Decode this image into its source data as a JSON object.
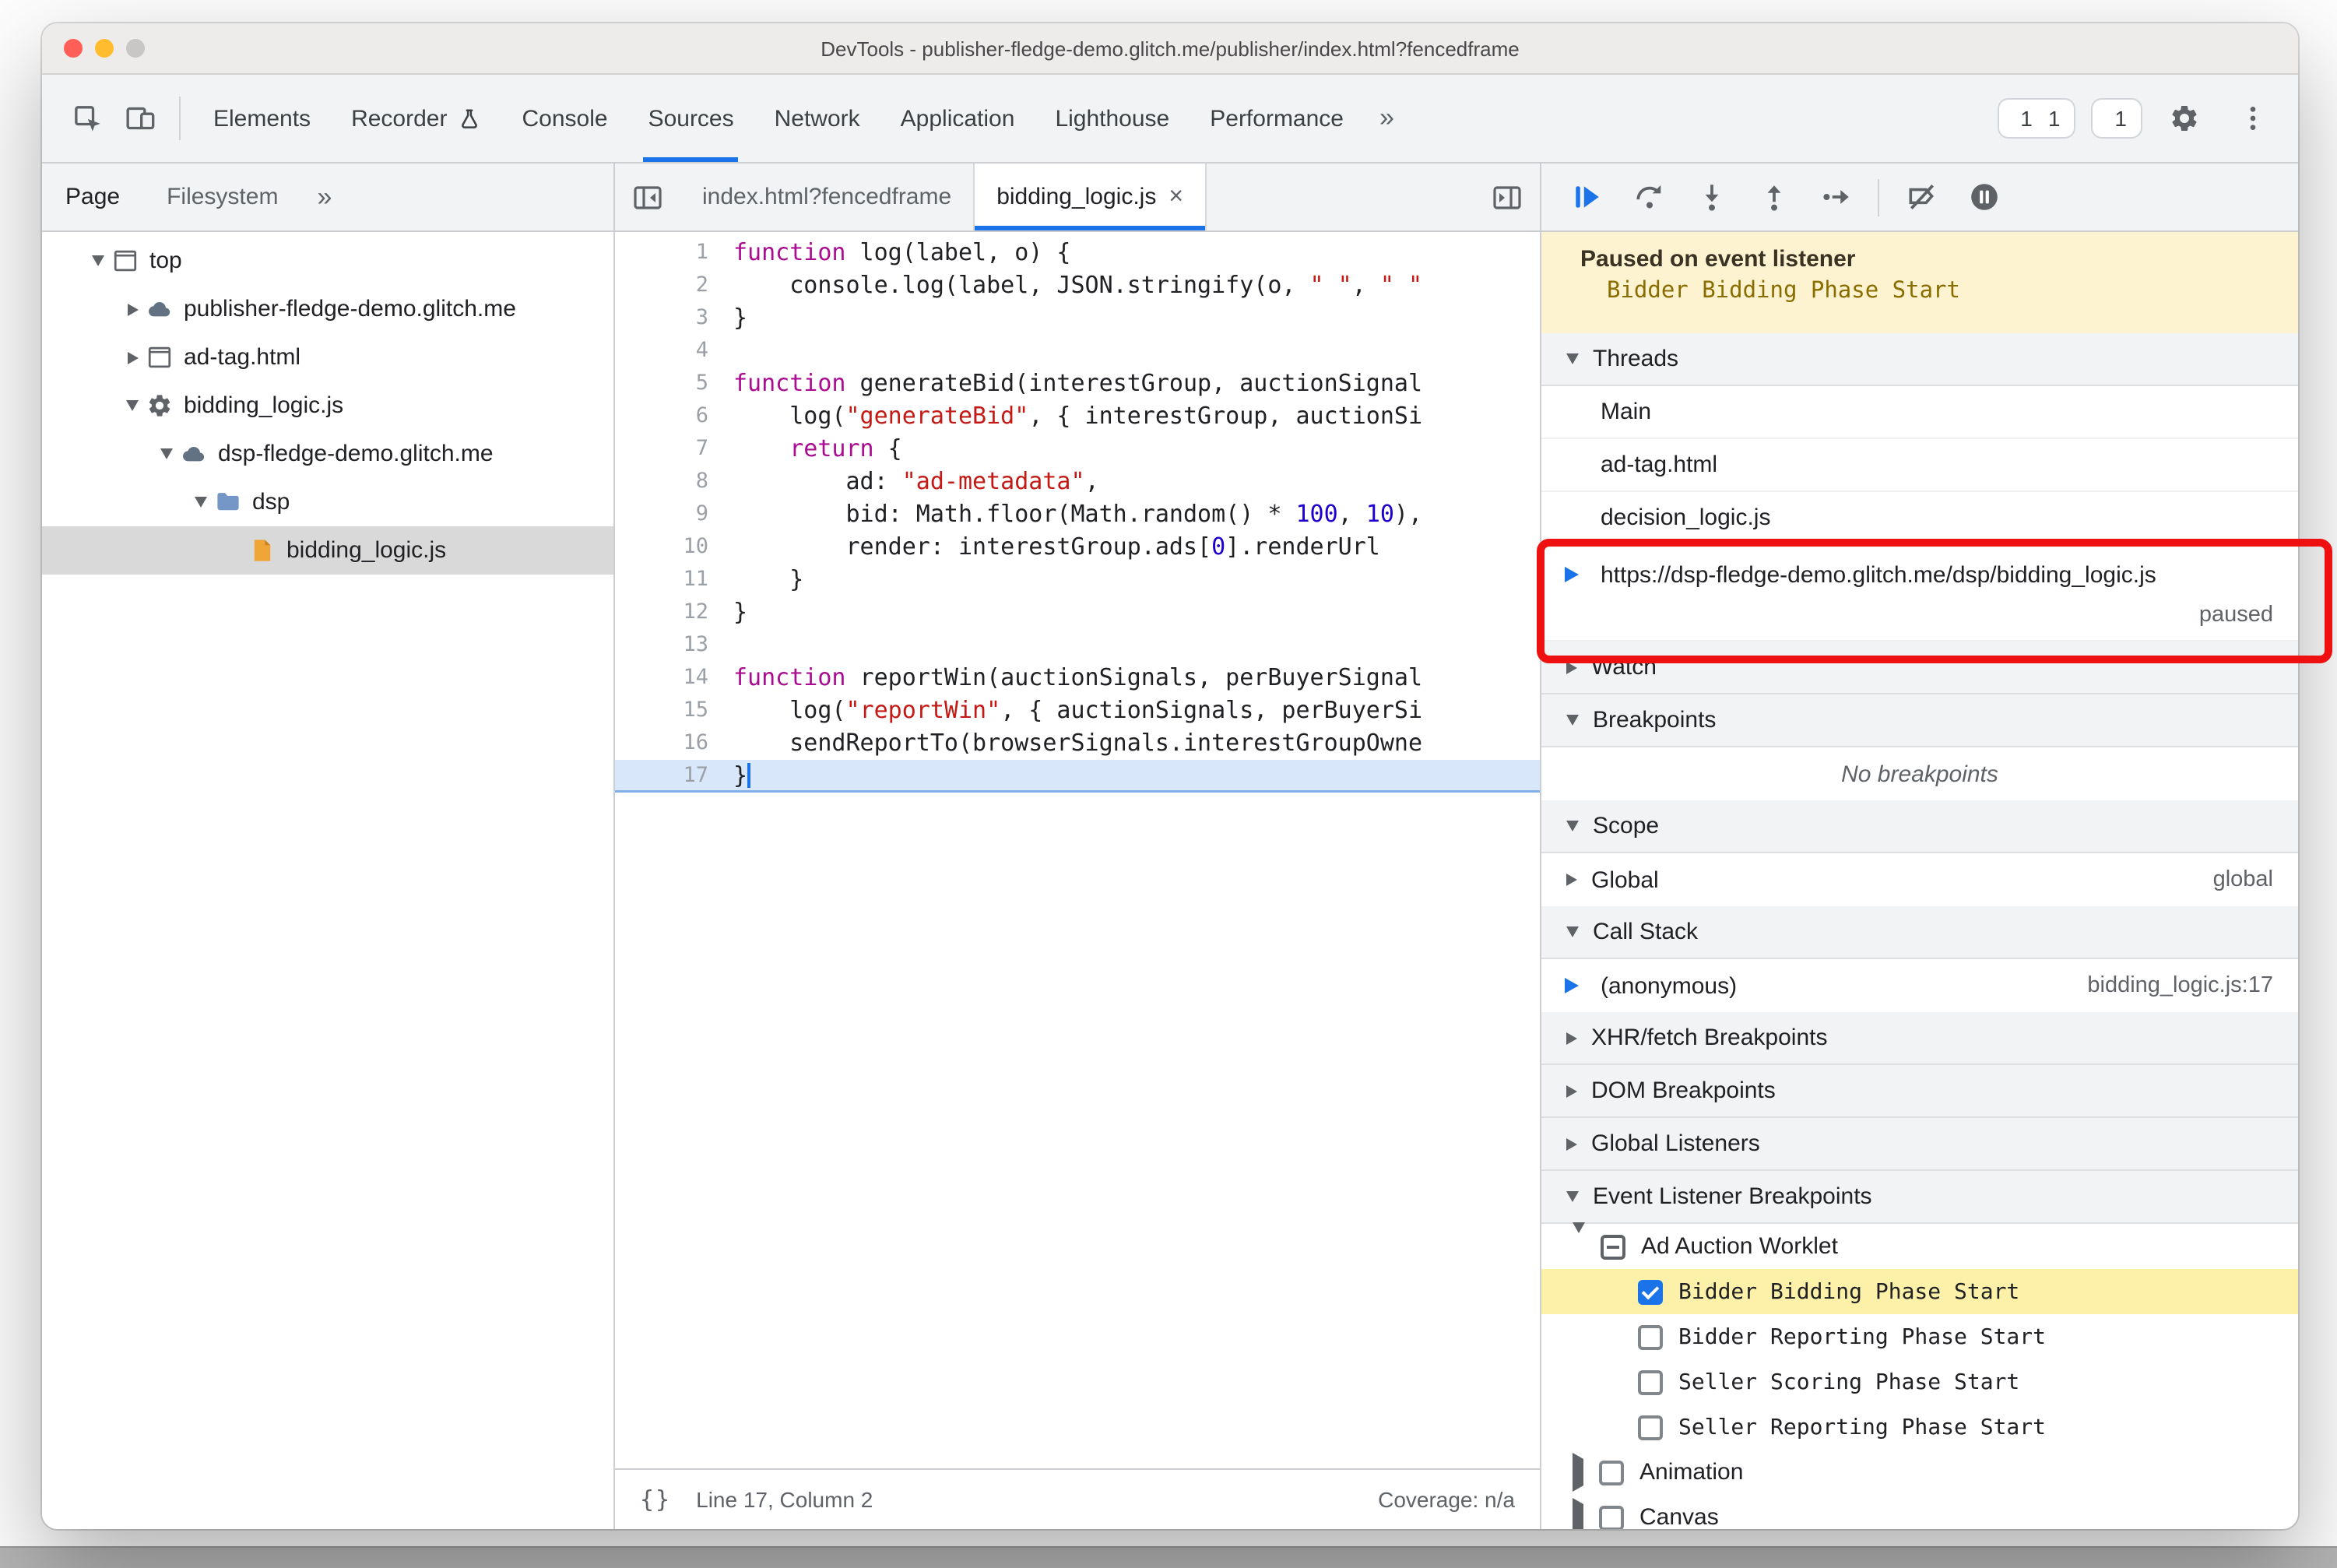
{
  "window": {
    "title": "DevTools - publisher-fledge-demo.glitch.me/publisher/index.html?fencedframe"
  },
  "colors": {
    "accent": "#1a73e8",
    "error": "#e5443f",
    "warning": "#f0a30a",
    "annotation": "#ef1111",
    "banner_bg": "#fdf3d0",
    "banner_text": "#8a6d00",
    "paused_line_bg": "#d9e7fb",
    "selected_tree_row": "#d9d9d9",
    "highlight_row": "#fdf1a9",
    "keyword": "#aa0d91",
    "string": "#c41a16",
    "number": "#1c00cf"
  },
  "main_toolbar": {
    "left_icons": [
      "inspect-icon",
      "device-toolbar-icon"
    ],
    "tabs": [
      {
        "label": "Elements"
      },
      {
        "label": "Recorder",
        "trailing_icon": "experiment-icon"
      },
      {
        "label": "Console"
      },
      {
        "label": "Sources",
        "selected": true
      },
      {
        "label": "Network"
      },
      {
        "label": "Application"
      },
      {
        "label": "Lighthouse"
      },
      {
        "label": "Performance"
      }
    ],
    "more_label": "»",
    "error_count": "1",
    "warning_count": "1",
    "issues_count": "1"
  },
  "navigator": {
    "tabs": [
      {
        "label": "Page",
        "selected": true
      },
      {
        "label": "Filesystem"
      }
    ],
    "more_label": "»",
    "tree": [
      {
        "label": "top",
        "icon": "frame-icon",
        "depth": 0,
        "expanded": true
      },
      {
        "label": "publisher-fledge-demo.glitch.me",
        "icon": "cloud-icon",
        "depth": 1,
        "expanded": false
      },
      {
        "label": "ad-tag.html",
        "icon": "frame-icon",
        "depth": 1,
        "expanded": false
      },
      {
        "label": "bidding_logic.js",
        "icon": "worklet-gear-icon",
        "depth": 1,
        "expanded": true
      },
      {
        "label": "dsp-fledge-demo.glitch.me",
        "icon": "cloud-icon",
        "depth": 2,
        "expanded": true
      },
      {
        "label": "dsp",
        "icon": "folder-icon",
        "depth": 3,
        "expanded": true
      },
      {
        "label": "bidding_logic.js",
        "icon": "file-js-icon",
        "depth": 4,
        "selected": true
      }
    ]
  },
  "editor": {
    "tabs": [
      {
        "label": "index.html?fencedframe"
      },
      {
        "label": "bidding_logic.js",
        "active": true,
        "closable": true
      }
    ],
    "paused_line": 17,
    "caret": {
      "line": 17,
      "column": 2
    },
    "lines": [
      {
        "n": 1,
        "t": [
          [
            "k",
            "function"
          ],
          [
            "p",
            " log(label, o) {"
          ]
        ]
      },
      {
        "n": 2,
        "t": [
          [
            "p",
            "    console.log(label, JSON.stringify(o, "
          ],
          [
            "s",
            "\" \""
          ],
          [
            "p",
            ", "
          ],
          [
            "s",
            "\" \""
          ]
        ]
      },
      {
        "n": 3,
        "t": [
          [
            "p",
            "}"
          ]
        ]
      },
      {
        "n": 4,
        "t": []
      },
      {
        "n": 5,
        "t": [
          [
            "k",
            "function"
          ],
          [
            "p",
            " generateBid(interestGroup, auctionSignal"
          ]
        ]
      },
      {
        "n": 6,
        "t": [
          [
            "p",
            "    log("
          ],
          [
            "s",
            "\"generateBid\""
          ],
          [
            "p",
            ", { interestGroup, auctionSi"
          ]
        ]
      },
      {
        "n": 7,
        "t": [
          [
            "p",
            "    "
          ],
          [
            "k",
            "return"
          ],
          [
            "p",
            " {"
          ]
        ]
      },
      {
        "n": 8,
        "t": [
          [
            "p",
            "        ad: "
          ],
          [
            "s",
            "\"ad-metadata\""
          ],
          [
            "p",
            ","
          ]
        ]
      },
      {
        "n": 9,
        "t": [
          [
            "p",
            "        bid: Math.floor(Math.random() * "
          ],
          [
            "n",
            "100"
          ],
          [
            "p",
            ", "
          ],
          [
            "n",
            "10"
          ],
          [
            "p",
            "),"
          ]
        ]
      },
      {
        "n": 10,
        "t": [
          [
            "p",
            "        render: interestGroup.ads["
          ],
          [
            "n",
            "0"
          ],
          [
            "p",
            "].renderUrl"
          ]
        ]
      },
      {
        "n": 11,
        "t": [
          [
            "p",
            "    }"
          ]
        ]
      },
      {
        "n": 12,
        "t": [
          [
            "p",
            "}"
          ]
        ]
      },
      {
        "n": 13,
        "t": []
      },
      {
        "n": 14,
        "t": [
          [
            "k",
            "function"
          ],
          [
            "p",
            " reportWin(auctionSignals, perBuyerSignal"
          ]
        ]
      },
      {
        "n": 15,
        "t": [
          [
            "p",
            "    log("
          ],
          [
            "s",
            "\"reportWin\""
          ],
          [
            "p",
            ", { auctionSignals, perBuyerSi"
          ]
        ]
      },
      {
        "n": 16,
        "t": [
          [
            "p",
            "    sendReportTo(browserSignals.interestGroupOwne"
          ]
        ]
      },
      {
        "n": 17,
        "t": [
          [
            "p",
            "}"
          ]
        ]
      }
    ],
    "status": {
      "pretty_print": "{}",
      "line_col": "Line 17, Column 2",
      "coverage": "Coverage: n/a"
    }
  },
  "debugger": {
    "toolbar_icons": [
      "resume-icon",
      "step-over-icon",
      "step-into-icon",
      "step-out-icon",
      "step-icon",
      "deactivate-breakpoints-icon",
      "pause-on-exceptions-icon"
    ],
    "banner": {
      "title": "Paused on event listener",
      "subtitle": "Bidder Bidding Phase Start"
    },
    "threads": {
      "header": "Threads",
      "items": [
        {
          "label": "Main"
        },
        {
          "label": "ad-tag.html"
        },
        {
          "label": "decision_logic.js"
        },
        {
          "label": "https://dsp-fledge-demo.glitch.me/dsp/bidding_logic.js",
          "active": true,
          "status": "paused"
        }
      ]
    },
    "watch": {
      "header": "Watch"
    },
    "breakpoints": {
      "header": "Breakpoints",
      "empty": "No breakpoints"
    },
    "scope": {
      "header": "Scope",
      "rows": [
        {
          "label": "Global",
          "value": "global"
        }
      ]
    },
    "call_stack": {
      "header": "Call Stack",
      "rows": [
        {
          "label": "(anonymous)",
          "location": "bidding_logic.js:17",
          "active": true
        }
      ]
    },
    "xhr": {
      "header": "XHR/fetch Breakpoints"
    },
    "dom": {
      "header": "DOM Breakpoints"
    },
    "global_listeners": {
      "header": "Global Listeners"
    },
    "elb": {
      "header": "Event Listener Breakpoints",
      "categories": [
        {
          "label": "Ad Auction Worklet",
          "state": "indeterminate",
          "expanded": true,
          "children": [
            {
              "label": "Bidder Bidding Phase Start",
              "checked": true,
              "highlighted": true
            },
            {
              "label": "Bidder Reporting Phase Start",
              "checked": false
            },
            {
              "label": "Seller Scoring Phase Start",
              "checked": false
            },
            {
              "label": "Seller Reporting Phase Start",
              "checked": false
            }
          ]
        },
        {
          "label": "Animation",
          "state": "unchecked",
          "expanded": false
        },
        {
          "label": "Canvas",
          "state": "unchecked",
          "expanded": false
        }
      ]
    }
  },
  "annotation": {
    "shape": "red-rounded-rectangle",
    "around": "paused bidding_logic.js thread row"
  }
}
